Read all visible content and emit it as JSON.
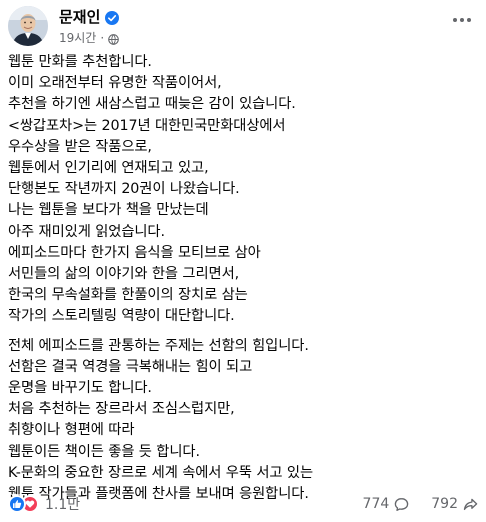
{
  "header": {
    "author_name": "문재인",
    "verified": true,
    "timestamp": "19시간",
    "separator": "·",
    "privacy_icon": "globe-icon",
    "more_icon": "more-options-icon"
  },
  "post": {
    "paragraphs": [
      [
        "웹툰 만화를 추천합니다.",
        "이미 오래전부터 유명한 작품이어서,",
        "추천을 하기엔 새삼스럽고 때늦은 감이 있습니다.",
        "<쌍갑포차>는 2017년 대한민국만화대상에서",
        "우수상을 받은 작품으로,",
        "웹툰에서 인기리에 연재되고 있고,",
        "단행본도 작년까지 20권이 나왔습니다.",
        "나는 웹툰을 보다가 책을 만났는데",
        "아주 재미있게 읽었습니다.",
        "에피소드마다 한가지 음식을 모티브로 삼아",
        "서민들의 삶의 이야기와 한을 그리면서,",
        "한국의 무속설화를 한풀이의 장치로 삼는",
        "작가의 스토리텔링 역량이 대단합니다."
      ],
      [
        "전체 에피소드를 관통하는 주제는 선함의 힘입니다.",
        "선함은 결국 역경을 극복해내는 힘이 되고",
        "운명을 바꾸기도 합니다.",
        "처음 추천하는 장르라서 조심스럽지만,",
        "취향이나 형편에 따라",
        "웹툰이든 책이든 좋을 듯 합니다.",
        "K-문화의 중요한 장르로 세계 속에서 우뚝 서고 있는",
        "웹툰 작가들과 플랫폼에 찬사를 보내며 응원합니다."
      ]
    ]
  },
  "footer": {
    "reactions_count": "1.1만",
    "reaction_icons": [
      "like-icon",
      "love-icon"
    ],
    "comments_count": "774",
    "shares_count": "792",
    "comment_icon": "comment-icon",
    "share_icon": "share-icon"
  },
  "colors": {
    "text": "#050505",
    "muted": "#65676b",
    "like": "#1877f2",
    "love": "#f33e58",
    "verified": "#1877f2"
  }
}
